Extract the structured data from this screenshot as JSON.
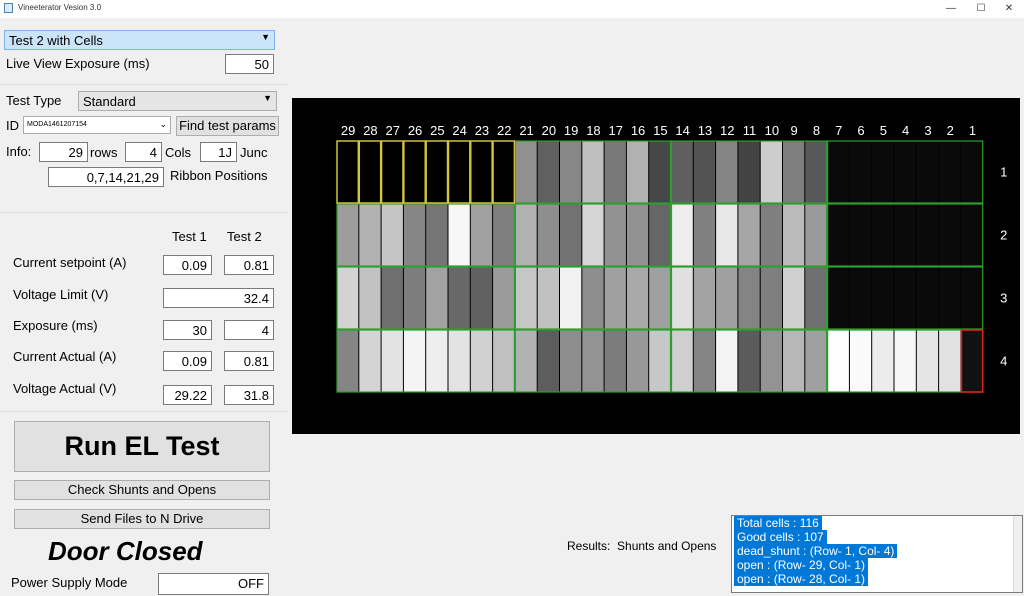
{
  "window": {
    "title": "Vineeterator Vesion 3.0",
    "minimize": "—",
    "maximize": "☐",
    "close": "✕"
  },
  "test_select": {
    "value": "Test 2 with Cells"
  },
  "live_view": {
    "label": "Live View Exposure (ms)",
    "value": "50"
  },
  "test_type": {
    "label": "Test Type",
    "value": "Standard"
  },
  "id_field": {
    "label": "ID",
    "value": "MODA1461207154",
    "find_button": "Find test params"
  },
  "info": {
    "label": "Info:",
    "rows_value": "29",
    "rows_label": "rows",
    "cols_value": "4",
    "cols_label": "Cols",
    "junc_value": "1J",
    "junc_label": "Junc",
    "ribbon_value": "0,7,14,21,29",
    "ribbon_label": "Ribbon Positions"
  },
  "params": {
    "header_test1": "Test 1",
    "header_test2": "Test 2",
    "current_setpoint": {
      "label": "Current setpoint (A)",
      "t1": "0.09",
      "t2": "0.81"
    },
    "voltage_limit": {
      "label": "Voltage Limit (V)",
      "value": "32.4"
    },
    "exposure": {
      "label": "Exposure (ms)",
      "t1": "30",
      "t2": "4"
    },
    "current_actual": {
      "label": "Current Actual (A)",
      "t1": "0.09",
      "t2": "0.81"
    },
    "voltage_actual": {
      "label": "Voltage Actual (V)",
      "t1": "29.22",
      "t2": "31.8"
    }
  },
  "buttons": {
    "run": "Run EL Test",
    "check": "Check Shunts and Opens",
    "send": "Send Files to N Drive"
  },
  "door_status": "Door Closed",
  "power_supply": {
    "label": "Power Supply Mode",
    "value": "OFF"
  },
  "preview": {
    "columns": [
      "29",
      "28",
      "27",
      "26",
      "25",
      "24",
      "23",
      "22",
      "21",
      "20",
      "19",
      "18",
      "17",
      "16",
      "15",
      "14",
      "13",
      "12",
      "11",
      "10",
      "9",
      "8",
      "7",
      "6",
      "5",
      "4",
      "3",
      "2",
      "1"
    ],
    "rows": [
      "1",
      "2",
      "3",
      "4"
    ],
    "colors": {
      "ok": "#2e9e2e",
      "flag_shunt": "#d8c43a",
      "flag_open": "#e02020"
    }
  },
  "results": {
    "label": "Results:",
    "mode": "Shunts and Opens",
    "lines": [
      "Total cells : 116",
      "Good  cells : 107",
      "dead_shunt : (Row- 1, Col- 4)",
      "open : (Row- 29, Col- 1)",
      "open : (Row- 28, Col- 1)"
    ]
  }
}
